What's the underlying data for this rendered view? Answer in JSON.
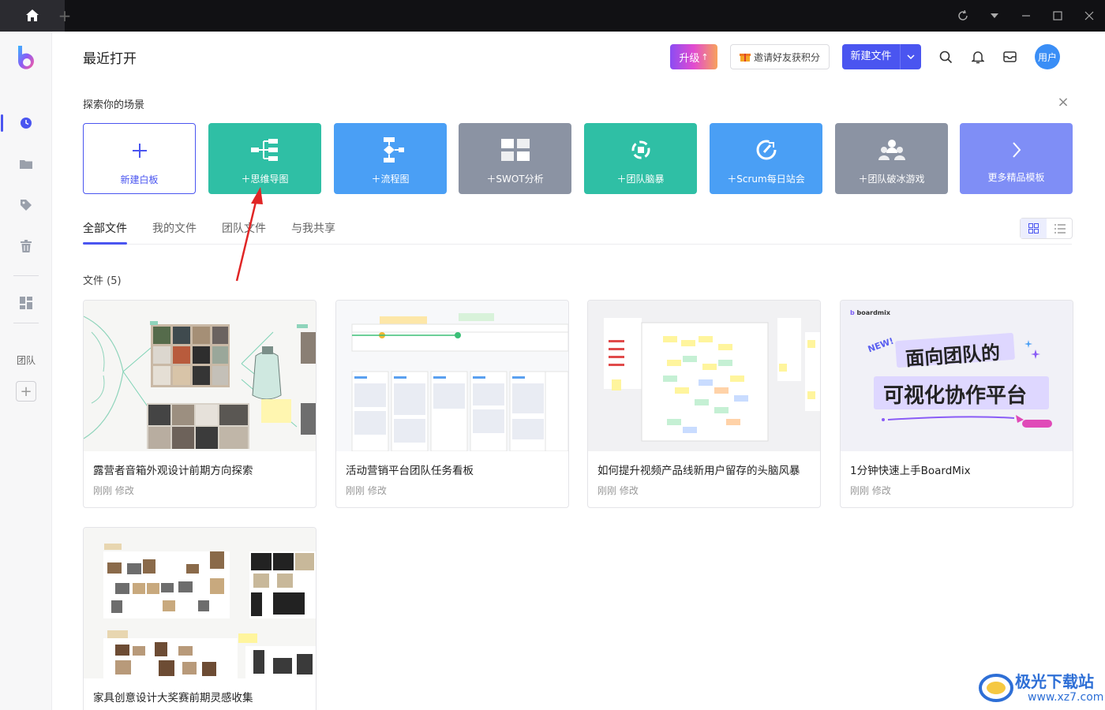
{
  "colors": {
    "accent": "#4a55f0",
    "teal": "#2fbfa5",
    "blue": "#4a9ff5",
    "gray": "#8b93a3",
    "purple": "#7f8ef6"
  },
  "header": {
    "title": "最近打开",
    "upgrade_label": "升级",
    "invite_label": "邀请好友获积分",
    "new_file_label": "新建文件",
    "avatar_label": "用户"
  },
  "sidebar": {
    "team_label": "团队"
  },
  "explore": {
    "label": "探索你的场景",
    "templates": [
      {
        "label": "新建白板",
        "icon": "plus-icon"
      },
      {
        "label": "＋思维导图",
        "icon": "mindmap-icon"
      },
      {
        "label": "＋流程图",
        "icon": "flowchart-icon"
      },
      {
        "label": "＋SWOT分析",
        "icon": "swot-icon"
      },
      {
        "label": "＋团队脑暴",
        "icon": "brainstorm-icon"
      },
      {
        "label": "＋Scrum每日站会",
        "icon": "scrum-icon"
      },
      {
        "label": "＋团队破冰游戏",
        "icon": "team-icon"
      },
      {
        "label": "更多精品模板",
        "icon": "chevron-right-icon"
      }
    ]
  },
  "tabs": [
    {
      "label": "全部文件"
    },
    {
      "label": "我的文件"
    },
    {
      "label": "团队文件"
    },
    {
      "label": "与我共享"
    }
  ],
  "files": {
    "count_label": "文件 (5)",
    "items": [
      {
        "title": "露营者音箱外观设计前期方向探索",
        "meta": "刚刚 修改"
      },
      {
        "title": "活动营销平台团队任务看板",
        "meta": "刚刚 修改"
      },
      {
        "title": "如何提升视频产品线新用户留存的头脑风暴",
        "meta": "刚刚 修改"
      },
      {
        "title": "1分钟快速上手BoardMix",
        "meta": "刚刚 修改"
      },
      {
        "title": "家具创意设计大奖赛前期灵感收集",
        "meta": ""
      }
    ]
  },
  "promo": {
    "brand": "boardmix",
    "badge": "NEW!",
    "line1": "面向团队的",
    "line2": "可视化协作平台"
  },
  "watermark": {
    "text": "极光下载站",
    "url": "www.xz7.com"
  }
}
